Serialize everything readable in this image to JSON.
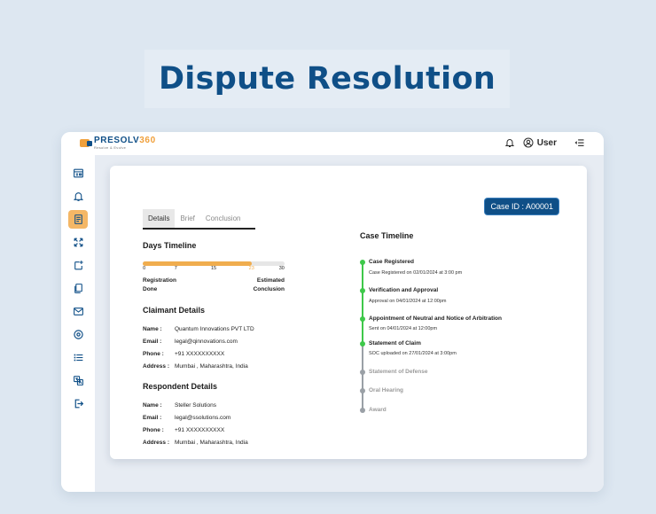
{
  "hero": {
    "title": "Dispute Resolution"
  },
  "app": {
    "logo_name": "PRESOLV",
    "logo_num": "360",
    "logo_tagline": "Resolve & Evolve",
    "user_label": "User"
  },
  "sidebar": {
    "icons": [
      "dashboard-icon",
      "bell-icon",
      "document-icon",
      "expand-icon",
      "new-case-icon",
      "files-icon",
      "mail-icon",
      "target-icon",
      "list-icon",
      "translate-icon",
      "logout-icon"
    ],
    "active_index": 2
  },
  "case": {
    "id_label": "Case ID : A00001"
  },
  "tabs": [
    {
      "label": "Details",
      "active": true
    },
    {
      "label": "Brief",
      "active": false
    },
    {
      "label": "Conclusion",
      "active": false
    }
  ],
  "days_timeline": {
    "title": "Days Timeline",
    "ticks": [
      "0",
      "7",
      "15",
      "23",
      "30"
    ],
    "current_day": 23,
    "max_day": 30,
    "left_label_1": "Registration",
    "left_label_2": "Done",
    "right_label_1": "Estimated",
    "right_label_2": "Conclusion"
  },
  "claimant": {
    "title": "Claimant Details",
    "rows": [
      {
        "k": "Name :",
        "v": "Quantum Innovations PVT LTD"
      },
      {
        "k": "Email :",
        "v": "legal@qinnovations.com"
      },
      {
        "k": "Phone :",
        "v": "+91 XXXXXXXXXX"
      },
      {
        "k": "Address :",
        "v": "Mumbai , Maharashtra, India"
      }
    ]
  },
  "respondent": {
    "title": "Respondent Details",
    "rows": [
      {
        "k": "Name :",
        "v": "Steller Solutions"
      },
      {
        "k": "Email :",
        "v": "legal@ssolutions.com"
      },
      {
        "k": "Phone :",
        "v": "+91 XXXXXXXXXX"
      },
      {
        "k": "Address :",
        "v": "Mumbai , Maharashtra, India"
      }
    ]
  },
  "case_timeline": {
    "title": "Case Timeline",
    "events": [
      {
        "title": "Case Registered",
        "sub": "Case Registered on 02/01/2024 at 3:00 pm",
        "done": true
      },
      {
        "title": "Verification and Approval",
        "sub": "Approval on  04/01/2024 at 12:00pm",
        "done": true
      },
      {
        "title": "Appointment of Neutral and Notice of Arbitration",
        "sub": "Sent on 04/01/2024 at 12:00pm",
        "done": true
      },
      {
        "title": "Statement of Claim",
        "sub": "SOC uploaded on 27/01/2024 at 3:00pm",
        "done": true
      },
      {
        "title": "Statement of Defense",
        "sub": "",
        "done": false
      },
      {
        "title": "Oral Hearing",
        "sub": "",
        "done": false
      },
      {
        "title": "Award",
        "sub": "",
        "done": false
      }
    ]
  }
}
